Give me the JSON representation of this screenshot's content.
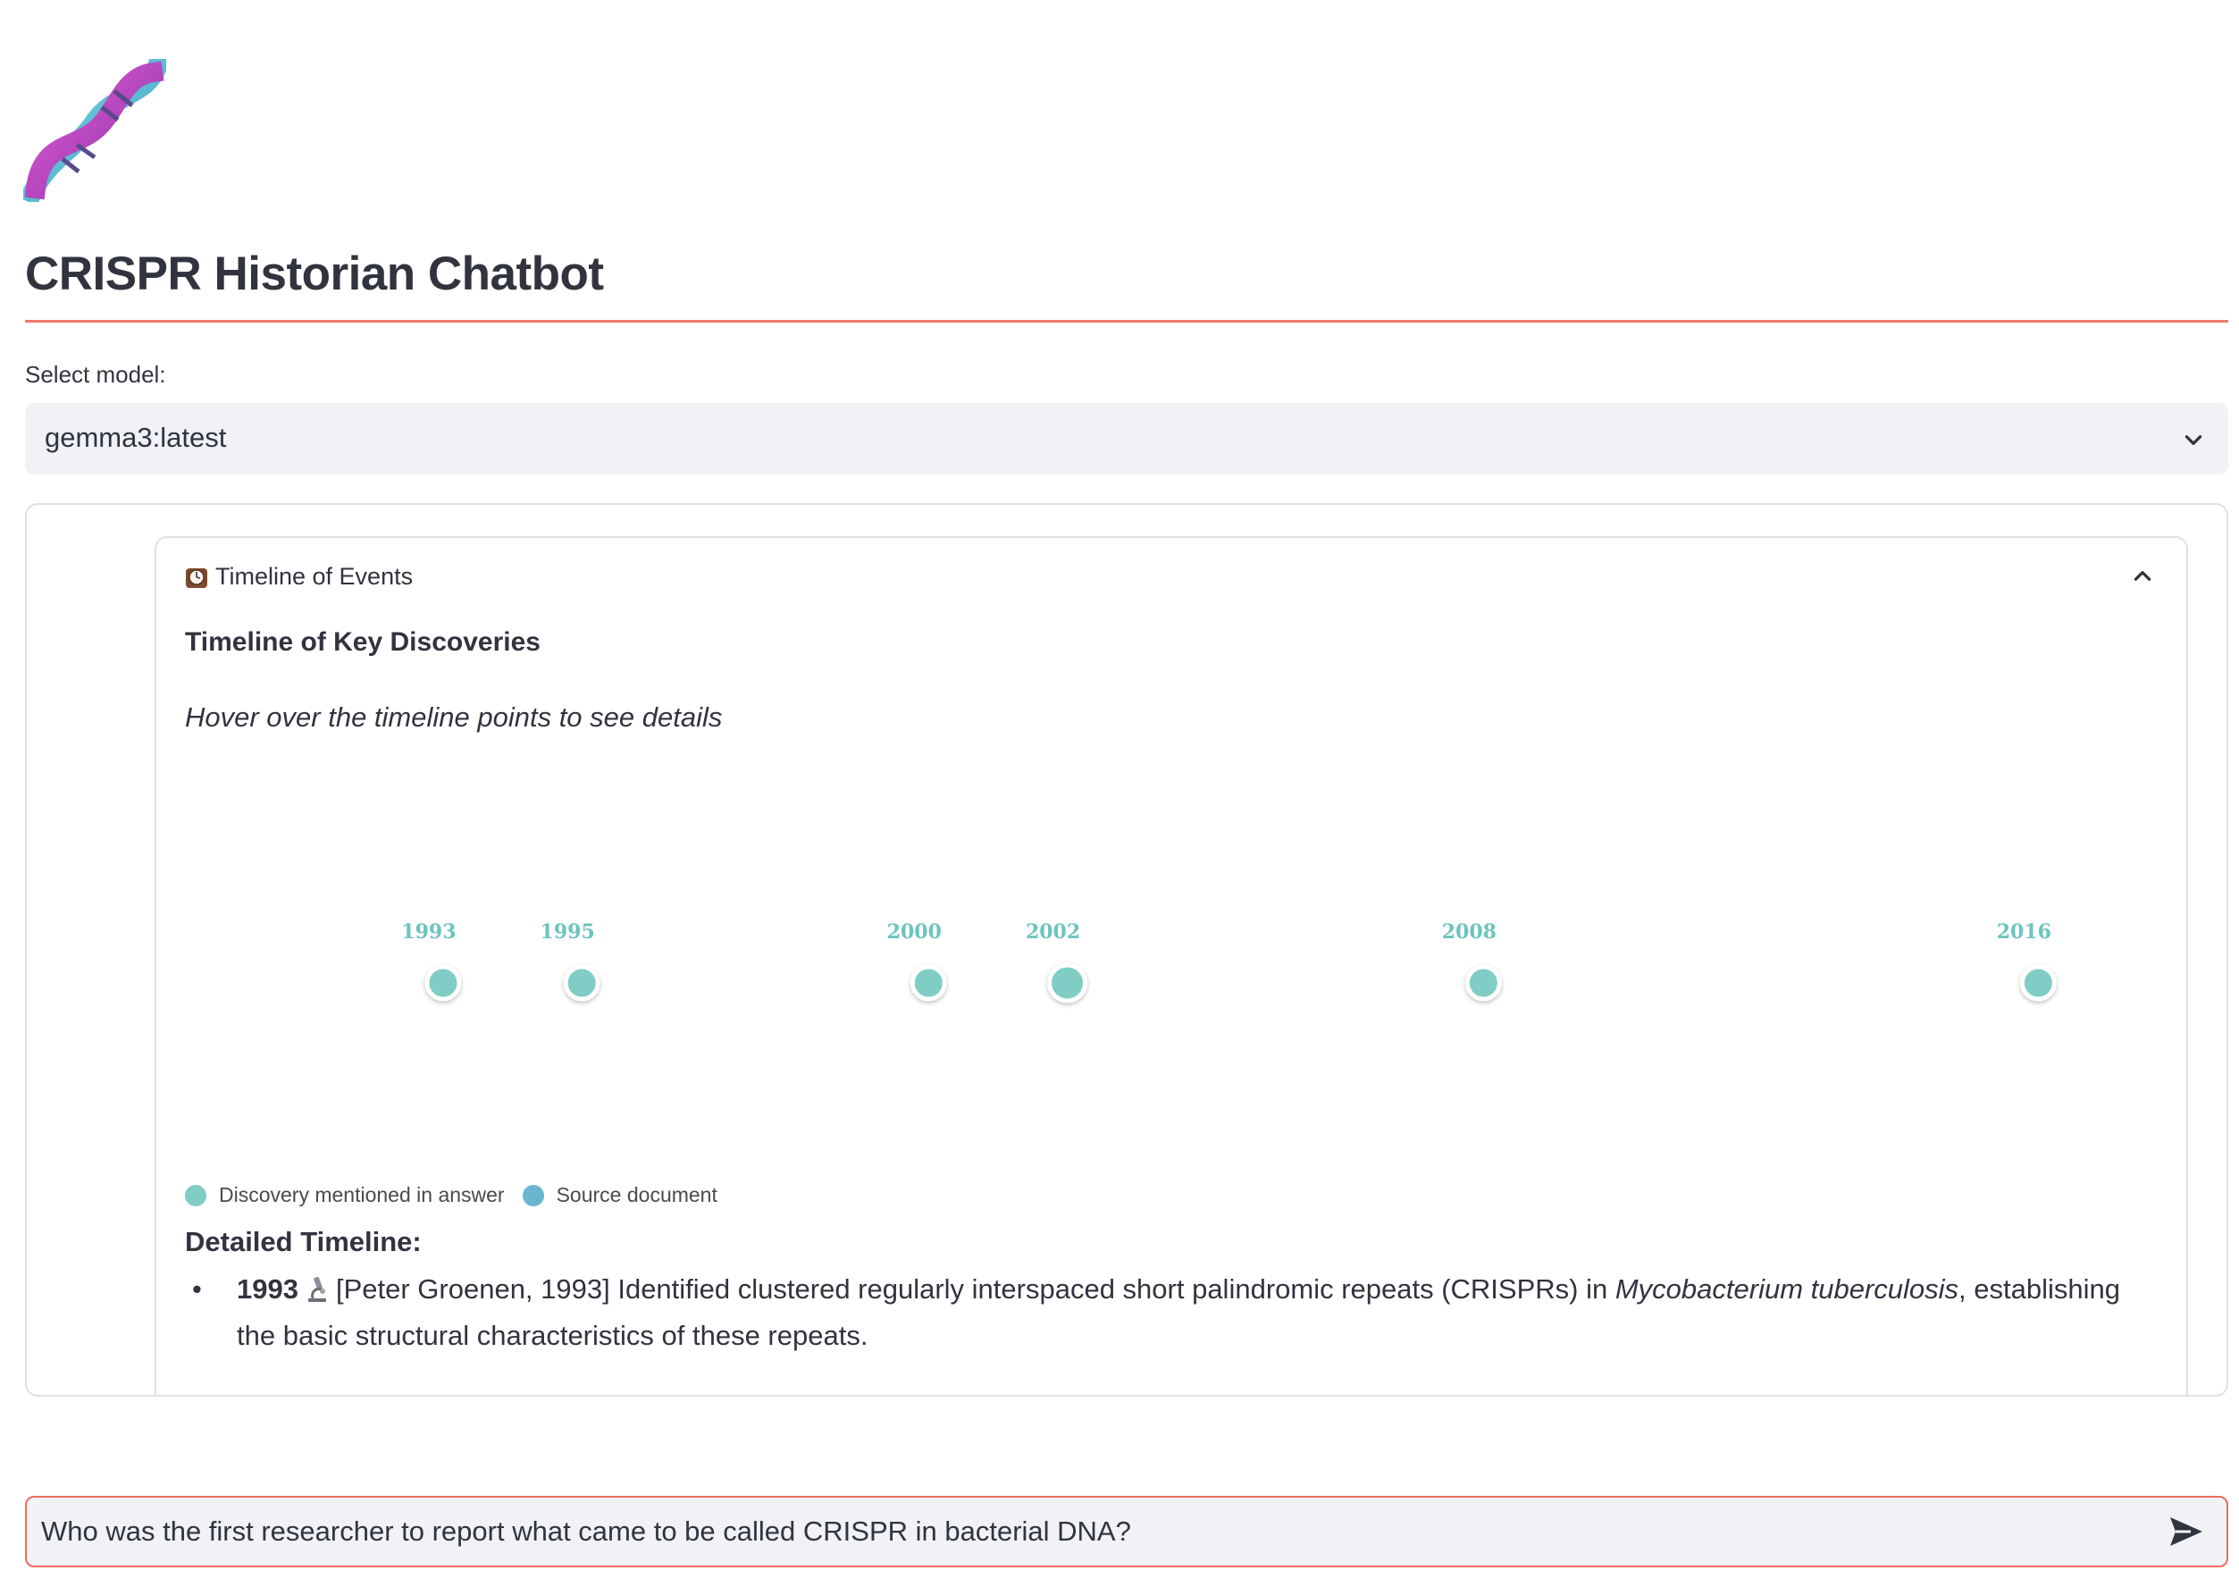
{
  "app": {
    "title": "CRISPR Historian Chatbot",
    "logo_icon": "dna-helix-icon"
  },
  "model_select": {
    "label": "Select model:",
    "value": "gemma3:latest"
  },
  "timeline_expander": {
    "header_icon": "clock-icon",
    "header": "Timeline of Events",
    "expanded": true,
    "heading": "Timeline of Key Discoveries",
    "hint": "Hover over the timeline points to see details",
    "chart_data": {
      "type": "scatter",
      "x": [
        1993,
        1995,
        2000,
        2002,
        2008,
        2016
      ],
      "labels": [
        "1993",
        "1995",
        "2000",
        "2002",
        "2008",
        "2016"
      ],
      "highlighted_year": 2002,
      "series": [
        {
          "name": "Discovery mentioned in answer",
          "color": "#7fcdc4"
        },
        {
          "name": "Source document",
          "color": "#6ab6cf"
        }
      ]
    },
    "legend": [
      "Discovery mentioned in answer",
      "Source document"
    ],
    "detail_heading": "Detailed Timeline:",
    "details": [
      {
        "year": "1993",
        "icon": "microscope-icon",
        "text_pre": "[Peter Groenen, 1993] Identified clustered regularly interspaced short palindromic repeats (CRISPRs) in ",
        "text_em": "Mycobacterium tuberculosis",
        "text_post": ", establishing the basic structural characteristics of these repeats."
      }
    ]
  },
  "chat_input": {
    "value": "Who was the first researcher to report what came to be called CRISPR in bacterial DNA?",
    "send_icon": "send-icon"
  },
  "colors": {
    "accent": "#ef6b5e",
    "timeline_light": "#7fcdc4",
    "timeline_dark": "#6ab6cf",
    "input_bg": "#f0f2f6"
  }
}
